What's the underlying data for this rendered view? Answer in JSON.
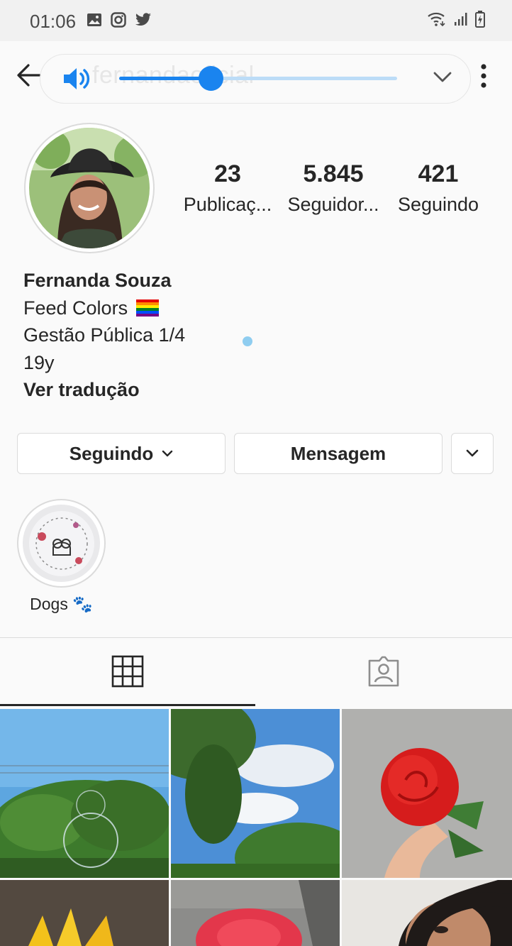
{
  "status_bar": {
    "time": "01:06",
    "icons": [
      "gallery-icon",
      "instagram-icon",
      "twitter-icon",
      "wifi-icon",
      "signal-icon",
      "battery-icon"
    ]
  },
  "header": {
    "username": "fernandaoficial",
    "volume_level": 0.33
  },
  "profile": {
    "stats": [
      {
        "value": "23",
        "label": "Publicaç..."
      },
      {
        "value": "5.845",
        "label": "Seguidor..."
      },
      {
        "value": "421",
        "label": "Seguindo"
      }
    ],
    "name": "Fernanda Souza",
    "bio_line1": "Feed Colors",
    "bio_line2": "Gestão Pública 1/4",
    "bio_line3": "19y",
    "translate": "Ver tradução"
  },
  "actions": {
    "following_label": "Seguindo",
    "message_label": "Mensagem"
  },
  "highlights": [
    {
      "label": "Dogs 🐾"
    }
  ],
  "tabs": [
    {
      "icon": "grid-icon",
      "active": true
    },
    {
      "icon": "tagged-icon",
      "active": false
    }
  ],
  "colors": {
    "accent": "#1a84ef",
    "text": "#262626",
    "border": "#dbdbdb"
  }
}
